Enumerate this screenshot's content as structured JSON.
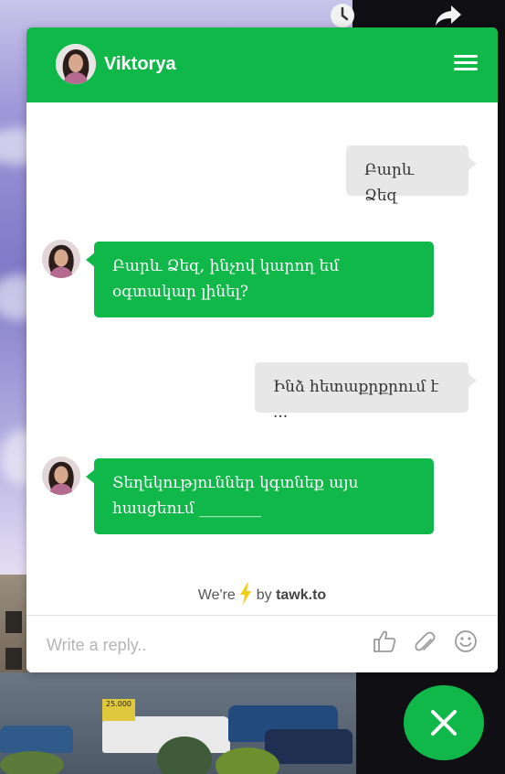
{
  "header": {
    "agent_name": "Viktorya"
  },
  "messages": [
    {
      "sender": "visitor",
      "lines": [
        "Բարև Ձեզ"
      ]
    },
    {
      "sender": "agent",
      "lines": [
        "Բարև Ձեզ, ինչով կարող եմ",
        "օգտակար լինել?"
      ]
    },
    {
      "sender": "visitor",
      "lines": [
        "Ինձ հետաքրքրում է ..."
      ]
    },
    {
      "sender": "agent",
      "lines": [
        "Տեղեկություններ կգտնեք այս",
        "հասցեում ________"
      ]
    }
  ],
  "branding": {
    "prefix": "We're",
    "by": "by",
    "brand": "tawk.to"
  },
  "composer": {
    "placeholder": "Write a reply.."
  },
  "icons": {
    "menu": "hamburger-icon",
    "like": "thumbs-up-icon",
    "attach": "paperclip-icon",
    "emoji": "smiley-icon",
    "close": "close-icon",
    "bolt": "lightning-icon"
  },
  "colors": {
    "accent": "#10b84a",
    "visitor_bubble": "#e7e7e7"
  },
  "background": {
    "sign_text": "25.000"
  }
}
